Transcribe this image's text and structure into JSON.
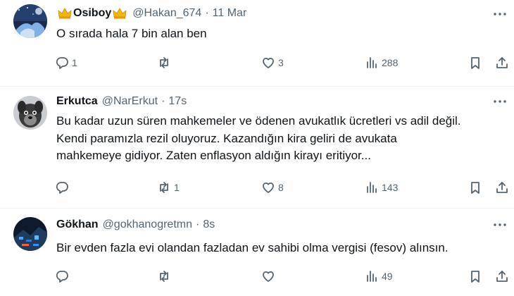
{
  "tweets": [
    {
      "name": "Osiboy",
      "handle": "@Hakan_674",
      "time": "11 Mar",
      "text": "O sırada hala 7 bin alan ben",
      "replies": "1",
      "reposts": "",
      "likes": "3",
      "views": "288",
      "avatar_icon": "anime-night-sky-avatar",
      "name_decoration": "crown-emoji"
    },
    {
      "name": "Erkutca",
      "handle": "@NarErkut",
      "time": "17s",
      "text": "Bu kadar uzun süren mahkemeler ve ödenen avukatlık ücretleri vs adil değil.\nKendi paramızla rezil oluyoruz.  Kazandığın kira geliri de avukata\nmahkemeye gidiyor.  Zaten enflasyon aldığın kirayı eritiyor...",
      "replies": "",
      "reposts": "1",
      "likes": "8",
      "views": "143",
      "avatar_icon": "dog-avatar"
    },
    {
      "name": "Gökhan",
      "handle": "@gokhanogretmn",
      "time": "8s",
      "text": "Bir evden fazla evi olandan fazladan ev sahibi olma vergisi (fesov) alınsın.",
      "replies": "",
      "reposts": "",
      "likes": "",
      "views": "49",
      "avatar_icon": "dark-tech-avatar"
    }
  ],
  "colors": {
    "text": "#0f1419",
    "secondary": "#536471",
    "divider": "#eff3f4",
    "crown": "#f5b50a"
  }
}
